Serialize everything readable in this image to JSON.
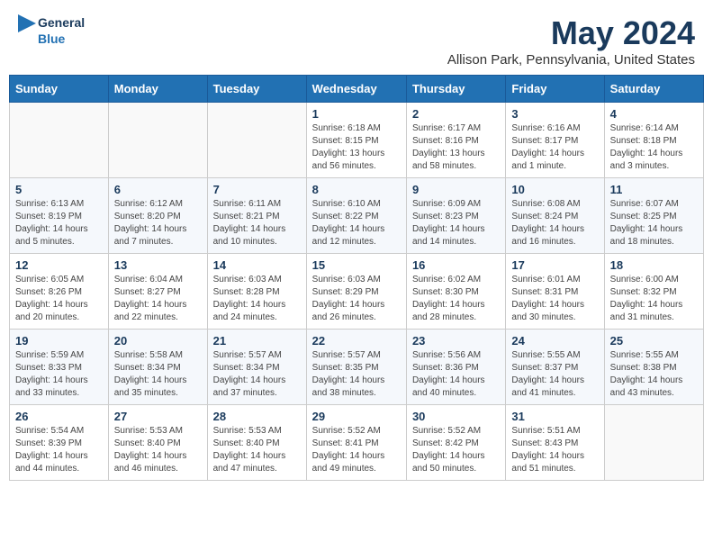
{
  "header": {
    "logo_line1": "General",
    "logo_line2": "Blue",
    "month_title": "May 2024",
    "location": "Allison Park, Pennsylvania, United States"
  },
  "weekdays": [
    "Sunday",
    "Monday",
    "Tuesday",
    "Wednesday",
    "Thursday",
    "Friday",
    "Saturday"
  ],
  "weeks": [
    [
      {
        "day": "",
        "sunrise": "",
        "sunset": "",
        "daylight": ""
      },
      {
        "day": "",
        "sunrise": "",
        "sunset": "",
        "daylight": ""
      },
      {
        "day": "",
        "sunrise": "",
        "sunset": "",
        "daylight": ""
      },
      {
        "day": "1",
        "sunrise": "Sunrise: 6:18 AM",
        "sunset": "Sunset: 8:15 PM",
        "daylight": "Daylight: 13 hours and 56 minutes."
      },
      {
        "day": "2",
        "sunrise": "Sunrise: 6:17 AM",
        "sunset": "Sunset: 8:16 PM",
        "daylight": "Daylight: 13 hours and 58 minutes."
      },
      {
        "day": "3",
        "sunrise": "Sunrise: 6:16 AM",
        "sunset": "Sunset: 8:17 PM",
        "daylight": "Daylight: 14 hours and 1 minute."
      },
      {
        "day": "4",
        "sunrise": "Sunrise: 6:14 AM",
        "sunset": "Sunset: 8:18 PM",
        "daylight": "Daylight: 14 hours and 3 minutes."
      }
    ],
    [
      {
        "day": "5",
        "sunrise": "Sunrise: 6:13 AM",
        "sunset": "Sunset: 8:19 PM",
        "daylight": "Daylight: 14 hours and 5 minutes."
      },
      {
        "day": "6",
        "sunrise": "Sunrise: 6:12 AM",
        "sunset": "Sunset: 8:20 PM",
        "daylight": "Daylight: 14 hours and 7 minutes."
      },
      {
        "day": "7",
        "sunrise": "Sunrise: 6:11 AM",
        "sunset": "Sunset: 8:21 PM",
        "daylight": "Daylight: 14 hours and 10 minutes."
      },
      {
        "day": "8",
        "sunrise": "Sunrise: 6:10 AM",
        "sunset": "Sunset: 8:22 PM",
        "daylight": "Daylight: 14 hours and 12 minutes."
      },
      {
        "day": "9",
        "sunrise": "Sunrise: 6:09 AM",
        "sunset": "Sunset: 8:23 PM",
        "daylight": "Daylight: 14 hours and 14 minutes."
      },
      {
        "day": "10",
        "sunrise": "Sunrise: 6:08 AM",
        "sunset": "Sunset: 8:24 PM",
        "daylight": "Daylight: 14 hours and 16 minutes."
      },
      {
        "day": "11",
        "sunrise": "Sunrise: 6:07 AM",
        "sunset": "Sunset: 8:25 PM",
        "daylight": "Daylight: 14 hours and 18 minutes."
      }
    ],
    [
      {
        "day": "12",
        "sunrise": "Sunrise: 6:05 AM",
        "sunset": "Sunset: 8:26 PM",
        "daylight": "Daylight: 14 hours and 20 minutes."
      },
      {
        "day": "13",
        "sunrise": "Sunrise: 6:04 AM",
        "sunset": "Sunset: 8:27 PM",
        "daylight": "Daylight: 14 hours and 22 minutes."
      },
      {
        "day": "14",
        "sunrise": "Sunrise: 6:03 AM",
        "sunset": "Sunset: 8:28 PM",
        "daylight": "Daylight: 14 hours and 24 minutes."
      },
      {
        "day": "15",
        "sunrise": "Sunrise: 6:03 AM",
        "sunset": "Sunset: 8:29 PM",
        "daylight": "Daylight: 14 hours and 26 minutes."
      },
      {
        "day": "16",
        "sunrise": "Sunrise: 6:02 AM",
        "sunset": "Sunset: 8:30 PM",
        "daylight": "Daylight: 14 hours and 28 minutes."
      },
      {
        "day": "17",
        "sunrise": "Sunrise: 6:01 AM",
        "sunset": "Sunset: 8:31 PM",
        "daylight": "Daylight: 14 hours and 30 minutes."
      },
      {
        "day": "18",
        "sunrise": "Sunrise: 6:00 AM",
        "sunset": "Sunset: 8:32 PM",
        "daylight": "Daylight: 14 hours and 31 minutes."
      }
    ],
    [
      {
        "day": "19",
        "sunrise": "Sunrise: 5:59 AM",
        "sunset": "Sunset: 8:33 PM",
        "daylight": "Daylight: 14 hours and 33 minutes."
      },
      {
        "day": "20",
        "sunrise": "Sunrise: 5:58 AM",
        "sunset": "Sunset: 8:34 PM",
        "daylight": "Daylight: 14 hours and 35 minutes."
      },
      {
        "day": "21",
        "sunrise": "Sunrise: 5:57 AM",
        "sunset": "Sunset: 8:34 PM",
        "daylight": "Daylight: 14 hours and 37 minutes."
      },
      {
        "day": "22",
        "sunrise": "Sunrise: 5:57 AM",
        "sunset": "Sunset: 8:35 PM",
        "daylight": "Daylight: 14 hours and 38 minutes."
      },
      {
        "day": "23",
        "sunrise": "Sunrise: 5:56 AM",
        "sunset": "Sunset: 8:36 PM",
        "daylight": "Daylight: 14 hours and 40 minutes."
      },
      {
        "day": "24",
        "sunrise": "Sunrise: 5:55 AM",
        "sunset": "Sunset: 8:37 PM",
        "daylight": "Daylight: 14 hours and 41 minutes."
      },
      {
        "day": "25",
        "sunrise": "Sunrise: 5:55 AM",
        "sunset": "Sunset: 8:38 PM",
        "daylight": "Daylight: 14 hours and 43 minutes."
      }
    ],
    [
      {
        "day": "26",
        "sunrise": "Sunrise: 5:54 AM",
        "sunset": "Sunset: 8:39 PM",
        "daylight": "Daylight: 14 hours and 44 minutes."
      },
      {
        "day": "27",
        "sunrise": "Sunrise: 5:53 AM",
        "sunset": "Sunset: 8:40 PM",
        "daylight": "Daylight: 14 hours and 46 minutes."
      },
      {
        "day": "28",
        "sunrise": "Sunrise: 5:53 AM",
        "sunset": "Sunset: 8:40 PM",
        "daylight": "Daylight: 14 hours and 47 minutes."
      },
      {
        "day": "29",
        "sunrise": "Sunrise: 5:52 AM",
        "sunset": "Sunset: 8:41 PM",
        "daylight": "Daylight: 14 hours and 49 minutes."
      },
      {
        "day": "30",
        "sunrise": "Sunrise: 5:52 AM",
        "sunset": "Sunset: 8:42 PM",
        "daylight": "Daylight: 14 hours and 50 minutes."
      },
      {
        "day": "31",
        "sunrise": "Sunrise: 5:51 AM",
        "sunset": "Sunset: 8:43 PM",
        "daylight": "Daylight: 14 hours and 51 minutes."
      },
      {
        "day": "",
        "sunrise": "",
        "sunset": "",
        "daylight": ""
      }
    ]
  ]
}
